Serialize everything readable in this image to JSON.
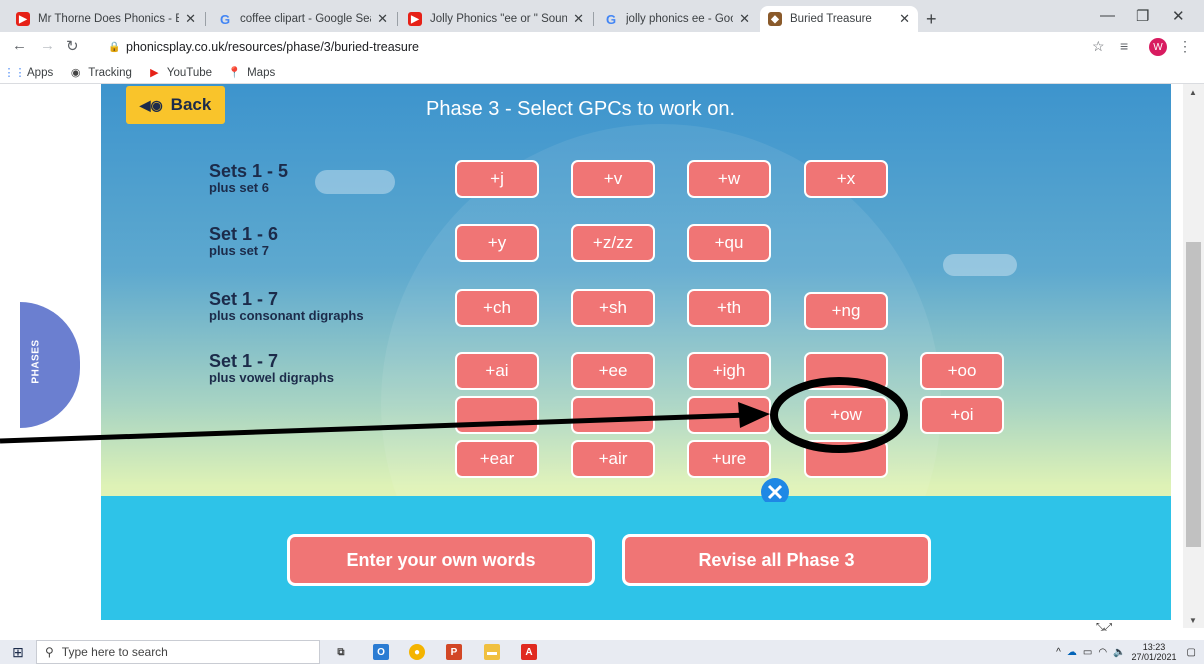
{
  "browser": {
    "tabs": [
      {
        "title": "Mr Thorne Does Phonics - Episo",
        "favicon": "youtube-icon",
        "active": false
      },
      {
        "title": "coffee clipart - Google Search",
        "favicon": "google-icon",
        "active": false
      },
      {
        "title": "Jolly Phonics \"ee or \" Sounds - Yo",
        "favicon": "youtube-icon",
        "active": false
      },
      {
        "title": "jolly phonics ee - Google Search",
        "favicon": "google-icon",
        "active": false
      },
      {
        "title": "Buried Treasure",
        "favicon": "buried-treasure-icon",
        "active": true
      }
    ],
    "url": "phonicsplay.co.uk/resources/phase/3/buried-treasure",
    "profile_initial": "W",
    "bookmarks": [
      {
        "label": "Apps",
        "icon": "apps-grid-icon"
      },
      {
        "label": "Tracking",
        "icon": "tracking-icon"
      },
      {
        "label": "YouTube",
        "icon": "youtube-icon"
      },
      {
        "label": "Maps",
        "icon": "maps-pin-icon"
      }
    ]
  },
  "game": {
    "back_label": "Back",
    "title": "Phase 3 - Select GPCs to work on.",
    "sets": [
      {
        "title": "Sets 1 - 5",
        "subtitle": "plus set 6",
        "buttons": [
          "+j",
          "+v",
          "+w",
          "+x"
        ]
      },
      {
        "title": "Set 1 - 6",
        "subtitle": "plus set 7",
        "buttons": [
          "+y",
          "+z/zz",
          "+qu"
        ]
      },
      {
        "title": "Set 1 - 7",
        "subtitle": "plus consonant digraphs",
        "buttons": [
          "+ch",
          "+sh",
          "+th",
          "+ng"
        ]
      },
      {
        "title": "Set 1 - 7",
        "subtitle": "plus vowel digraphs",
        "rows": [
          [
            "+ai",
            "+ee",
            "+igh",
            "",
            "+oo"
          ],
          [
            "",
            "",
            "",
            "+ow",
            "+oi"
          ],
          [
            "+ear",
            "+air",
            "+ure",
            ""
          ]
        ]
      }
    ],
    "enter_words_label": "Enter your own words",
    "revise_label": "Revise all Phase 3",
    "phases_tab": "PHASES",
    "colors": {
      "button": "#f07575",
      "back": "#f9c42b",
      "sea": "#2ec3e8",
      "phases": "#6b7fd0",
      "annotation": "#000000"
    }
  },
  "taskbar": {
    "search_placeholder": "Type here to search",
    "time": "13:23",
    "date": "27/01/2021"
  }
}
